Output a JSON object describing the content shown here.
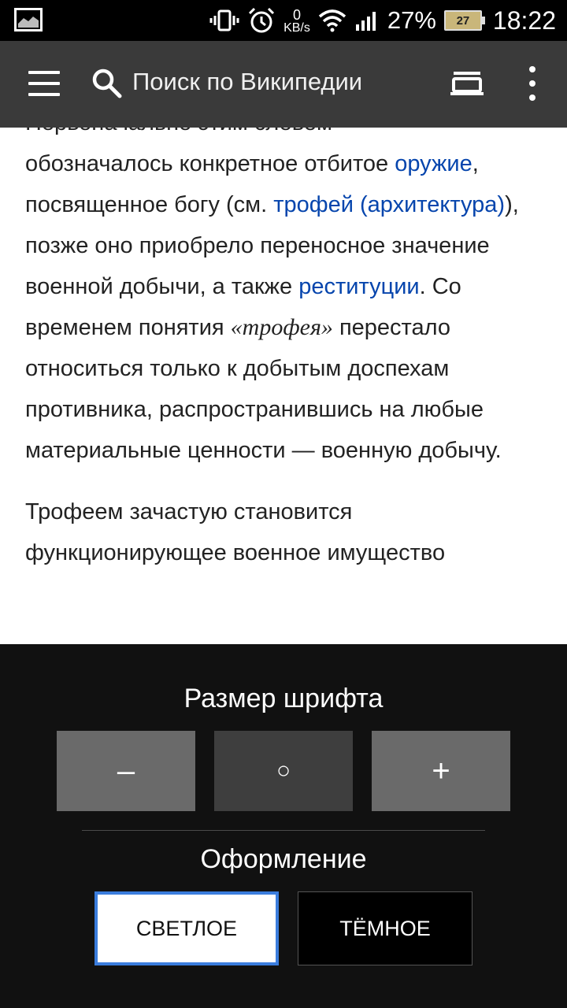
{
  "status_bar": {
    "net_speed_value": "0",
    "net_speed_unit": "KB/s",
    "battery_percent": "27%",
    "battery_level": "27",
    "time": "18:22",
    "icons": [
      "gallery-icon",
      "vibrate-icon",
      "alarm-icon",
      "wifi-icon",
      "signal-icon",
      "battery-icon"
    ]
  },
  "toolbar": {
    "search_placeholder": "Поиск по Википедии",
    "icons": [
      "menu-icon",
      "search-icon",
      "reading-list-icon",
      "more-options-icon"
    ]
  },
  "article": {
    "partial_top_line": "Первоначально этим словом",
    "p1": {
      "t1": "обозначалось конкретное отбитое ",
      "link1": "оружие",
      "t2": ", посвященное богу (см. ",
      "link2": "трофей (архитектура)",
      "t3": "), позже оно приобрело переносное значение военной добычи, а также ",
      "link3": "реституции",
      "t4": ". Со временем понятия ",
      "em": "«трофея»",
      "t5": " перестало относиться только к добытым доспехам противника, распространившись на любые материальные ценности — военную добычу."
    },
    "p2": {
      "line1": "Трофеем зачастую становится",
      "line2_partial": "функционирующее военное имущество"
    }
  },
  "font_sheet": {
    "font_size_title": "Размер шрифта",
    "decrease_label": "–",
    "reset_label": "○",
    "increase_label": "+",
    "theme_title": "Оформление",
    "light_label": "СВЕТЛОЕ",
    "dark_label": "ТЁМНОЕ",
    "selected_theme": "light",
    "accent_color": "#3b7ddd",
    "link_color": "#0645ad"
  }
}
